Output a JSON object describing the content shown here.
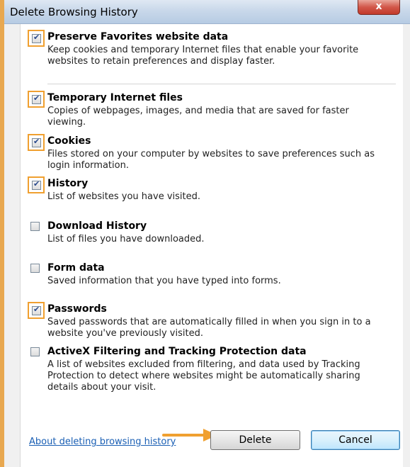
{
  "window": {
    "title": "Delete Browsing History",
    "close_label": "x"
  },
  "options": [
    {
      "key": "preserve_favorites",
      "title": "Preserve Favorites website data",
      "description": "Keep cookies and temporary Internet files that enable your favorite websites to retain preferences and display faster.",
      "checked": true,
      "highlighted": true
    },
    {
      "key": "temporary_files",
      "title": "Temporary Internet files",
      "description": "Copies of webpages, images, and media that are saved for faster viewing.",
      "checked": true,
      "highlighted": true
    },
    {
      "key": "cookies",
      "title": "Cookies",
      "description": "Files stored on your computer by websites to save preferences such as login information.",
      "checked": true,
      "highlighted": true
    },
    {
      "key": "history",
      "title": "History",
      "description": "List of websites you have visited.",
      "checked": true,
      "highlighted": true
    },
    {
      "key": "download_history",
      "title": "Download History",
      "description": "List of files you have downloaded.",
      "checked": false,
      "highlighted": false
    },
    {
      "key": "form_data",
      "title": "Form data",
      "description": "Saved information that you have typed into forms.",
      "checked": false,
      "highlighted": false
    },
    {
      "key": "passwords",
      "title": "Passwords",
      "description": "Saved passwords that are automatically filled in when you sign in to a website you've previously visited.",
      "checked": true,
      "highlighted": true
    },
    {
      "key": "activex_filtering",
      "title": "ActiveX Filtering and Tracking Protection data",
      "description": "A list of websites excluded from filtering, and data used by Tracking Protection to detect where websites might be automatically sharing details about your visit.",
      "checked": false,
      "highlighted": false
    }
  ],
  "footer": {
    "about_link": "About deleting browsing history",
    "delete_label": "Delete",
    "cancel_label": "Cancel"
  },
  "colors": {
    "highlight": "#f0a030",
    "arrow": "#f0a030",
    "link": "#1a5fb4"
  }
}
